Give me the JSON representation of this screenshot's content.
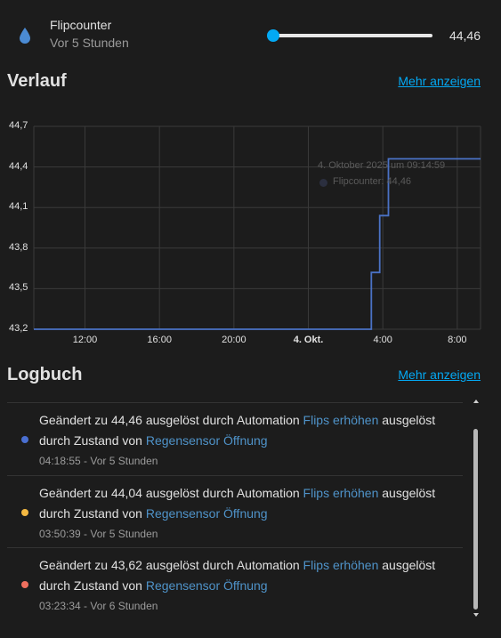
{
  "entity": {
    "name": "Flipcounter",
    "last_changed": "Vor 5 Stunden",
    "value": "44,46",
    "slider_fraction": 0.0,
    "icon": "water-drop-icon"
  },
  "history": {
    "title": "Verlauf",
    "more_link": "Mehr anzeigen"
  },
  "chart_data": {
    "type": "line",
    "y_ticks": [
      "44,7",
      "44,4",
      "44,1",
      "43,8",
      "43,5",
      "43,2"
    ],
    "x_ticks": [
      "12:00",
      "16:00",
      "20:00",
      "4. Okt.",
      "4:00",
      "8:00"
    ],
    "x_tick_bold": [
      false,
      false,
      false,
      true,
      false,
      false
    ],
    "ylim": [
      43.2,
      44.7
    ],
    "step": true,
    "series": [
      {
        "name": "Flipcounter",
        "color": "#4a72c5",
        "points": [
          {
            "t": "3. Okt. 09:15",
            "y": 43.2
          },
          {
            "t": "4. Okt. 03:23",
            "y": 43.2
          },
          {
            "t": "4. Okt. 03:23",
            "y": 43.62
          },
          {
            "t": "4. Okt. 03:50",
            "y": 43.62
          },
          {
            "t": "4. Okt. 03:50",
            "y": 44.04
          },
          {
            "t": "4. Okt. 04:18",
            "y": 44.04
          },
          {
            "t": "4. Okt. 04:18",
            "y": 44.46
          },
          {
            "t": "4. Okt. 09:15",
            "y": 44.46
          }
        ]
      }
    ],
    "tooltip": {
      "title": "4. Oktober 2025 um 09:14:59",
      "label": "Flipcounter: 44,46"
    }
  },
  "logbook": {
    "title": "Logbuch",
    "more_link": "Mehr anzeigen",
    "entries": [
      {
        "prefix": "Geändert zu 44,46 ausgelöst durch Automation ",
        "automation": "Flips erhöhen",
        "middle": " ausgelöst durch Zustand von ",
        "sensor": "Regensensor Öffnung",
        "time": "04:18:55 - Vor 5 Stunden",
        "dot_color": "#4a6fd1"
      },
      {
        "prefix": "Geändert zu 44,04 ausgelöst durch Automation ",
        "automation": "Flips erhöhen",
        "middle": " ausgelöst durch Zustand von ",
        "sensor": "Regensensor Öffnung",
        "time": "03:50:39 - Vor 5 Stunden",
        "dot_color": "#f4b942"
      },
      {
        "prefix": "Geändert zu 43,62 ausgelöst durch Automation ",
        "automation": "Flips erhöhen",
        "middle": " ausgelöst durch Zustand von ",
        "sensor": "Regensensor Öffnung",
        "time": "03:23:34 - Vor 6 Stunden",
        "dot_color": "#ef6f5e"
      }
    ]
  }
}
